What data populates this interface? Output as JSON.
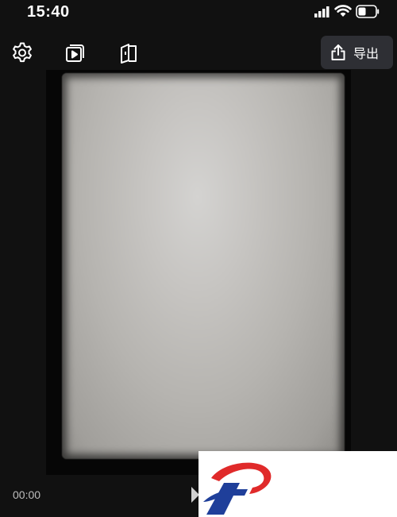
{
  "status_bar": {
    "time": "15:40",
    "icons": [
      "cellular-signal-icon",
      "wifi-icon",
      "battery-icon"
    ]
  },
  "toolbar": {
    "icons": [
      "gear-icon",
      "preview-play-icon",
      "book-icon"
    ],
    "export_label": "导出",
    "export_icon": "share-upload-icon"
  },
  "player": {
    "current_time": "00:00"
  },
  "colors": {
    "background": "#111111",
    "export_button_bg": "#2e2f34",
    "annotation_arrow": "#e8332f",
    "logo_red": "#e02a2a",
    "logo_blue": "#1f3f9a"
  }
}
